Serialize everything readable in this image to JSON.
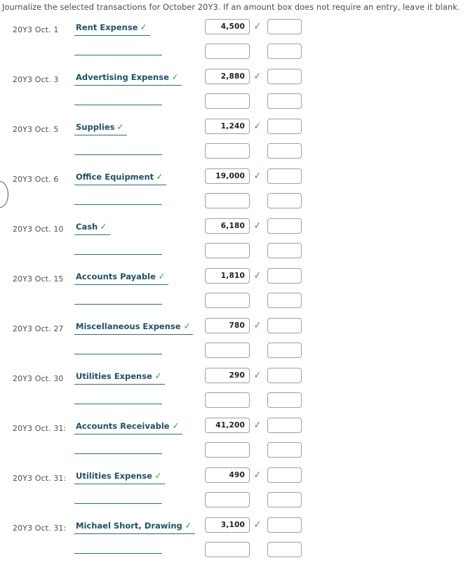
{
  "instruction": "Journalize the selected transactions for October 20Y3. If an amount box does not require an entry, leave it blank.",
  "icons": {
    "check": "✓"
  },
  "colors": {
    "account_text": "#1f5066",
    "account_underline": "#2e6a85",
    "check_green": "#2e9b39",
    "box_border": "#a0a0a0",
    "instruction_text": "#4a4a4a"
  },
  "entries": [
    {
      "date": "20Y3 Oct. 1",
      "debit_account": "Rent Expense",
      "debit_account_verified": true,
      "credit_account": "",
      "debit_amount": "4,500",
      "debit_amount_verified": true,
      "credit_amount": "",
      "debit_amount_2": "",
      "credit_amount_2": ""
    },
    {
      "date": "20Y3 Oct. 3",
      "debit_account": "Advertising Expense",
      "debit_account_verified": true,
      "credit_account": "",
      "debit_amount": "2,880",
      "debit_amount_verified": true,
      "credit_amount": "",
      "debit_amount_2": "",
      "credit_amount_2": ""
    },
    {
      "date": "20Y3 Oct. 5",
      "debit_account": "Supplies",
      "debit_account_verified": true,
      "credit_account": "",
      "debit_amount": "1,240",
      "debit_amount_verified": true,
      "credit_amount": "",
      "debit_amount_2": "",
      "credit_amount_2": ""
    },
    {
      "date": "20Y3 Oct. 6",
      "debit_account": "Office Equipment",
      "debit_account_verified": true,
      "credit_account": "",
      "debit_amount": "19,000",
      "debit_amount_verified": true,
      "credit_amount": "",
      "debit_amount_2": "",
      "credit_amount_2": ""
    },
    {
      "date": "20Y3 Oct. 10",
      "debit_account": "Cash",
      "debit_account_verified": true,
      "credit_account": "",
      "debit_amount": "6,180",
      "debit_amount_verified": true,
      "credit_amount": "",
      "debit_amount_2": "",
      "credit_amount_2": ""
    },
    {
      "date": "20Y3 Oct. 15",
      "debit_account": "Accounts Payable",
      "debit_account_verified": true,
      "credit_account": "",
      "debit_amount": "1,810",
      "debit_amount_verified": true,
      "credit_amount": "",
      "debit_amount_2": "",
      "credit_amount_2": ""
    },
    {
      "date": "20Y3 Oct. 27",
      "debit_account": "Miscellaneous Expense",
      "debit_account_verified": true,
      "credit_account": "",
      "debit_amount": "780",
      "debit_amount_verified": true,
      "credit_amount": "",
      "debit_amount_2": "",
      "credit_amount_2": ""
    },
    {
      "date": "20Y3 Oct. 30",
      "debit_account": "Utilities Expense",
      "debit_account_verified": true,
      "credit_account": "",
      "debit_amount": "290",
      "debit_amount_verified": true,
      "credit_amount": "",
      "debit_amount_2": "",
      "credit_amount_2": ""
    },
    {
      "date": "20Y3 Oct. 31:",
      "debit_account": "Accounts Receivable",
      "debit_account_verified": true,
      "credit_account": "",
      "debit_amount": "41,200",
      "debit_amount_verified": true,
      "credit_amount": "",
      "debit_amount_2": "",
      "credit_amount_2": ""
    },
    {
      "date": "20Y3 Oct. 31:",
      "debit_account": "Utilities Expense",
      "debit_account_verified": true,
      "credit_account": "",
      "debit_amount": "490",
      "debit_amount_verified": true,
      "credit_amount": "",
      "debit_amount_2": "",
      "credit_amount_2": ""
    },
    {
      "date": "20Y3 Oct. 31:",
      "debit_account": "Michael Short, Drawing",
      "debit_account_verified": true,
      "credit_account": "",
      "debit_amount": "3,100",
      "debit_amount_verified": true,
      "credit_amount": "",
      "debit_amount_2": "",
      "credit_amount_2": ""
    }
  ]
}
